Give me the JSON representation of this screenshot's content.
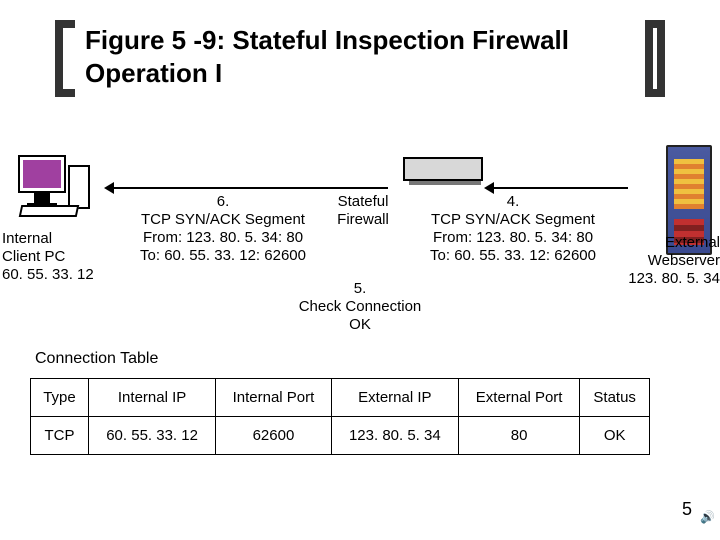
{
  "title": "Figure 5 -9: Stateful Inspection Firewall Operation I",
  "pc": {
    "line1": "Internal",
    "line2": "Client PC",
    "line3": "60. 55. 33. 12"
  },
  "firewall_label": "Stateful Firewall",
  "seg6": {
    "num": "6.",
    "l1": "TCP SYN/ACK Segment",
    "l2": "From: 123. 80. 5. 34: 80",
    "l3": "To: 60. 55. 33. 12: 62600"
  },
  "seg4": {
    "num": "4.",
    "l1": "TCP SYN/ACK Segment",
    "l2": "From: 123. 80. 5. 34: 80",
    "l3": "To: 60. 55. 33. 12: 62600"
  },
  "server": {
    "line1": "External",
    "line2": "Webserver",
    "line3": "123. 80. 5. 34"
  },
  "step5": {
    "num": "5.",
    "l1": "Check Connection",
    "l2": "OK"
  },
  "conn_table": {
    "label": "Connection Table",
    "headers": [
      "Type",
      "Internal IP",
      "Internal Port",
      "External IP",
      "External Port",
      "Status"
    ],
    "row": [
      "TCP",
      "60. 55. 33. 12",
      "62600",
      "123. 80. 5. 34",
      "80",
      "OK"
    ]
  },
  "page_number": "5"
}
